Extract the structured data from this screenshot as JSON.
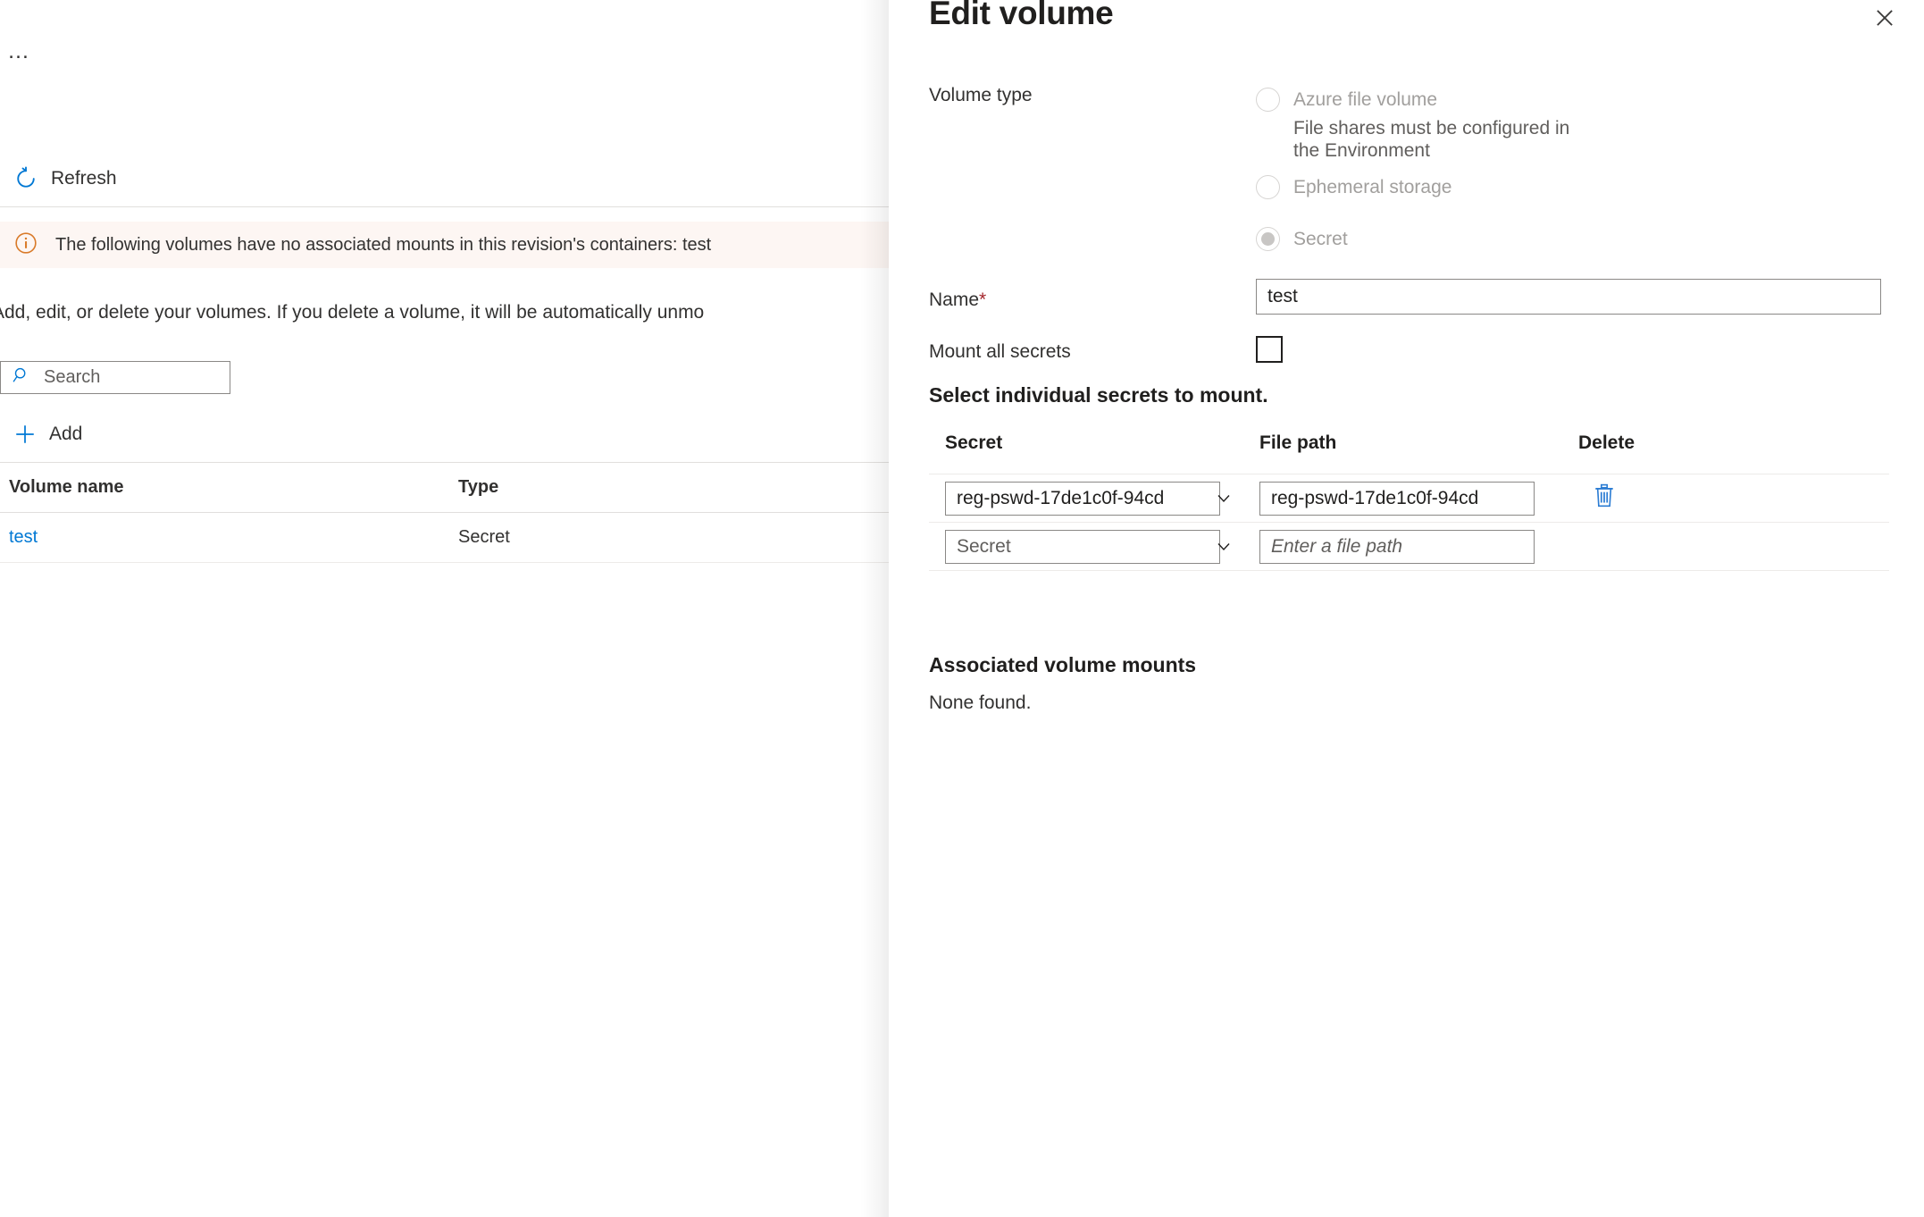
{
  "colors": {
    "accent": "#0078d4",
    "link": "#0078d4",
    "info_bg": "#fdf6f3",
    "info_icon": "#d97b2a",
    "required_star": "#a4262c",
    "disabled_text": "#a19f9d",
    "body_text": "#323130"
  },
  "left_blade": {
    "overflow_menu_label": "…",
    "commands": {
      "refresh_label": "Refresh",
      "add_label": "Add"
    },
    "info_banner": {
      "message": "The following volumes have no associated mounts in this revision's containers: test"
    },
    "description": "Add, edit, or delete your volumes. If you delete a volume, it will be automatically unmo",
    "search": {
      "placeholder": "Search",
      "value": ""
    },
    "volumes_table": {
      "columns": [
        "Volume name",
        "Type"
      ],
      "rows": [
        {
          "name": "test",
          "type": "Secret"
        }
      ]
    }
  },
  "panel": {
    "title": "Edit volume",
    "close_label": "✕",
    "volume_type": {
      "label": "Volume type",
      "options": [
        {
          "label": "Azure file volume",
          "description": "File shares must be configured in the Environment",
          "selected": false,
          "disabled": true
        },
        {
          "label": "Ephemeral storage",
          "description": "",
          "selected": false,
          "disabled": true
        },
        {
          "label": "Secret",
          "description": "",
          "selected": true,
          "disabled": true
        }
      ]
    },
    "name": {
      "label": "Name",
      "required_marker": "*",
      "value": "test",
      "placeholder": ""
    },
    "mount_all_secrets": {
      "label": "Mount all secrets",
      "checked": false
    },
    "select_secrets_heading": "Select individual secrets to mount.",
    "secrets_table": {
      "columns": [
        "Secret",
        "File path",
        "Delete"
      ],
      "rows": [
        {
          "secret_value": "reg-pswd-17de1c0f-94cd",
          "secret_is_placeholder": false,
          "file_path_value": "reg-pswd-17de1c0f-94cd",
          "file_path_placeholder": "Enter a file path",
          "has_delete": true
        },
        {
          "secret_value": "Secret",
          "secret_is_placeholder": true,
          "file_path_value": "",
          "file_path_placeholder": "Enter a file path",
          "has_delete": false
        }
      ]
    },
    "associated_volume_mounts": {
      "title": "Associated volume mounts",
      "empty_text": "None found."
    }
  }
}
